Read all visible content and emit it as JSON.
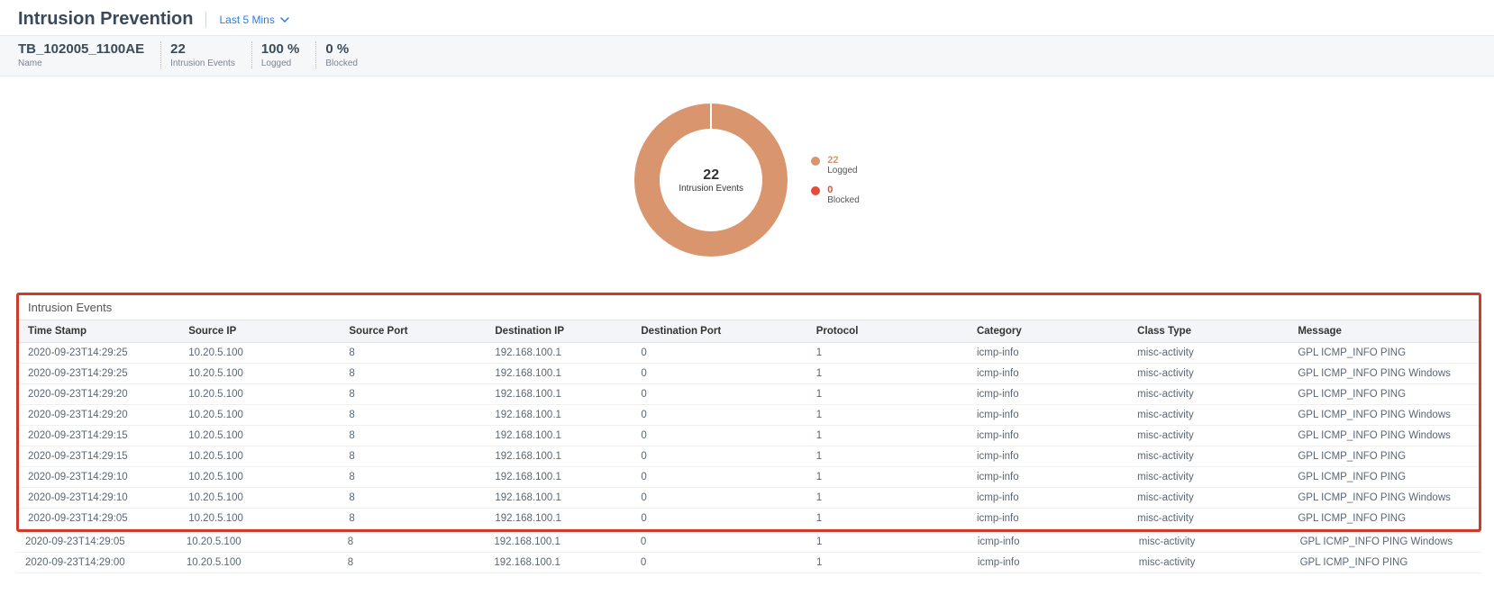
{
  "header": {
    "title": "Intrusion Prevention",
    "time_filter_label": "Last 5 Mins"
  },
  "stats": {
    "name_value": "TB_102005_1100AE",
    "name_label": "Name",
    "events_value": "22",
    "events_label": "Intrusion Events",
    "logged_value": "100 %",
    "logged_label": "Logged",
    "blocked_value": "0 %",
    "blocked_label": "Blocked"
  },
  "chart_data": {
    "type": "pie",
    "title": "",
    "total_label": "Intrusion Events",
    "total_value": "22",
    "series": [
      {
        "name": "Logged",
        "value": 22,
        "color": "#d9956e"
      },
      {
        "name": "Blocked",
        "value": 0,
        "color": "#e44b3a"
      }
    ]
  },
  "legend": {
    "logged_value": "22",
    "logged_label": "Logged",
    "blocked_value": "0",
    "blocked_label": "Blocked"
  },
  "events_panel": {
    "title": "Intrusion Events",
    "columns": [
      "Time Stamp",
      "Source IP",
      "Source Port",
      "Destination IP",
      "Destination Port",
      "Protocol",
      "Category",
      "Class Type",
      "Message"
    ],
    "rows": [
      [
        "2020-09-23T14:29:25",
        "10.20.5.100",
        "8",
        "192.168.100.1",
        "0",
        "1",
        "icmp-info",
        "misc-activity",
        "GPL ICMP_INFO PING"
      ],
      [
        "2020-09-23T14:29:25",
        "10.20.5.100",
        "8",
        "192.168.100.1",
        "0",
        "1",
        "icmp-info",
        "misc-activity",
        "GPL ICMP_INFO PING Windows"
      ],
      [
        "2020-09-23T14:29:20",
        "10.20.5.100",
        "8",
        "192.168.100.1",
        "0",
        "1",
        "icmp-info",
        "misc-activity",
        "GPL ICMP_INFO PING"
      ],
      [
        "2020-09-23T14:29:20",
        "10.20.5.100",
        "8",
        "192.168.100.1",
        "0",
        "1",
        "icmp-info",
        "misc-activity",
        "GPL ICMP_INFO PING Windows"
      ],
      [
        "2020-09-23T14:29:15",
        "10.20.5.100",
        "8",
        "192.168.100.1",
        "0",
        "1",
        "icmp-info",
        "misc-activity",
        "GPL ICMP_INFO PING Windows"
      ],
      [
        "2020-09-23T14:29:15",
        "10.20.5.100",
        "8",
        "192.168.100.1",
        "0",
        "1",
        "icmp-info",
        "misc-activity",
        "GPL ICMP_INFO PING"
      ],
      [
        "2020-09-23T14:29:10",
        "10.20.5.100",
        "8",
        "192.168.100.1",
        "0",
        "1",
        "icmp-info",
        "misc-activity",
        "GPL ICMP_INFO PING"
      ],
      [
        "2020-09-23T14:29:10",
        "10.20.5.100",
        "8",
        "192.168.100.1",
        "0",
        "1",
        "icmp-info",
        "misc-activity",
        "GPL ICMP_INFO PING Windows"
      ],
      [
        "2020-09-23T14:29:05",
        "10.20.5.100",
        "8",
        "192.168.100.1",
        "0",
        "1",
        "icmp-info",
        "misc-activity",
        "GPL ICMP_INFO PING"
      ]
    ],
    "overflow_rows": [
      [
        "2020-09-23T14:29:05",
        "10.20.5.100",
        "8",
        "192.168.100.1",
        "0",
        "1",
        "icmp-info",
        "misc-activity",
        "GPL ICMP_INFO PING Windows"
      ],
      [
        "2020-09-23T14:29:00",
        "10.20.5.100",
        "8",
        "192.168.100.1",
        "0",
        "1",
        "icmp-info",
        "misc-activity",
        "GPL ICMP_INFO PING"
      ]
    ]
  }
}
